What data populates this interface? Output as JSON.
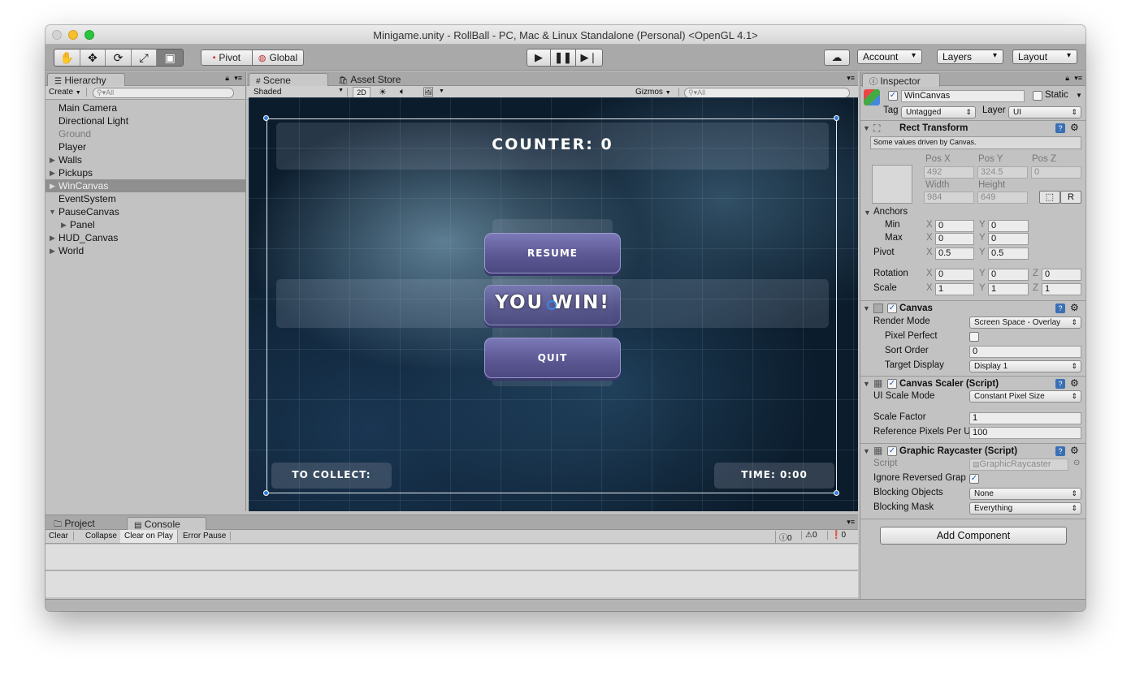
{
  "window": {
    "title": "Minigame.unity - RollBall - PC, Mac & Linux Standalone (Personal) <OpenGL 4.1>"
  },
  "toolbar": {
    "pivot_label": "Pivot",
    "global_label": "Global",
    "account_label": "Account",
    "layers_label": "Layers",
    "layout_label": "Layout"
  },
  "hierarchy": {
    "tab": "Hierarchy",
    "create_label": "Create",
    "search_placeholder": "All",
    "items": [
      {
        "label": "Main Camera"
      },
      {
        "label": "Directional Light"
      },
      {
        "label": "Ground"
      },
      {
        "label": "Player"
      },
      {
        "label": "Walls"
      },
      {
        "label": "Pickups"
      },
      {
        "label": "WinCanvas"
      },
      {
        "label": "EventSystem"
      },
      {
        "label": "PauseCanvas"
      },
      {
        "label": "Panel"
      },
      {
        "label": "HUD_Canvas"
      },
      {
        "label": "World"
      }
    ]
  },
  "scene": {
    "tabs": [
      {
        "label": "Scene"
      },
      {
        "label": "Asset Store"
      }
    ],
    "shading_mode": "Shaded",
    "mode_2d": "2D",
    "gizmos_label": "Gizmos",
    "search_placeholder": "All",
    "counter_text": "COUNTER: 0",
    "resume_label": "RESUME",
    "win_text": "YOU WIN!",
    "quit_label": "QUIT",
    "collect_text": "TO COLLECT:",
    "time_text": "TIME: 0:00"
  },
  "console": {
    "tabs": [
      {
        "label": "Project"
      },
      {
        "label": "Console"
      }
    ],
    "clear": "Clear",
    "collapse": "Collapse",
    "clear_on_play": "Clear on Play",
    "error_pause": "Error Pause",
    "info_count": "0",
    "warn_count": "0",
    "error_count": "0"
  },
  "inspector": {
    "tab": "Inspector",
    "object_name": "WinCanvas",
    "static_label": "Static",
    "tag_label": "Tag",
    "tag_value": "Untagged",
    "layer_label": "Layer",
    "layer_value": "UI",
    "rect": {
      "title": "Rect Transform",
      "note": "Some values driven by Canvas.",
      "posx_label": "Pos X",
      "posy_label": "Pos Y",
      "posz_label": "Pos Z",
      "posx": "492",
      "posy": "324.5",
      "posz": "0",
      "width_label": "Width",
      "height_label": "Height",
      "width": "984",
      "height": "649",
      "r_label": "R",
      "anchors_label": "Anchors",
      "min_label": "Min",
      "max_label": "Max",
      "pivot_label": "Pivot",
      "rotation_label": "Rotation",
      "scale_label": "Scale",
      "x": "X",
      "y": "Y",
      "z": "Z",
      "min_x": "0",
      "min_y": "0",
      "max_x": "0",
      "max_y": "0",
      "pivot_x": "0.5",
      "pivot_y": "0.5",
      "rot_x": "0",
      "rot_y": "0",
      "rot_z": "0",
      "scale_x": "1",
      "scale_y": "1",
      "scale_z": "1"
    },
    "canvas": {
      "title": "Canvas",
      "render_mode_label": "Render Mode",
      "render_mode": "Screen Space - Overlay",
      "pixel_perfect_label": "Pixel Perfect",
      "sort_order_label": "Sort Order",
      "sort_order": "0",
      "target_display_label": "Target Display",
      "target_display": "Display 1"
    },
    "scaler": {
      "title": "Canvas Scaler (Script)",
      "ui_scale_label": "UI Scale Mode",
      "ui_scale": "Constant Pixel Size",
      "scale_factor_label": "Scale Factor",
      "scale_factor": "1",
      "ref_pixels_label": "Reference Pixels Per U",
      "ref_pixels": "100"
    },
    "raycaster": {
      "title": "Graphic Raycaster (Script)",
      "script_label": "Script",
      "script_value": "GraphicRaycaster",
      "ignore_label": "Ignore Reversed Grap",
      "blocking_objects_label": "Blocking Objects",
      "blocking_objects": "None",
      "blocking_mask_label": "Blocking Mask",
      "blocking_mask": "Everything"
    },
    "add_component": "Add Component"
  }
}
